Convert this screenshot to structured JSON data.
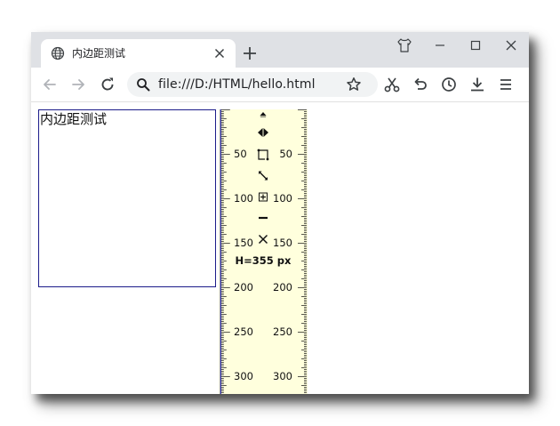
{
  "browser": {
    "tab_title": "内边距测试",
    "url": "file:///D:/HTML/hello.html"
  },
  "page": {
    "demo_text": "内边距测试"
  },
  "ruler": {
    "height_readout": "H=355 px",
    "labels": [
      "50",
      "100",
      "150",
      "200",
      "250",
      "300"
    ],
    "background": "#ffffdd"
  },
  "colors": {
    "titlebar": "#dfe1e5",
    "tab": "#ffffff",
    "omnibox": "#f1f3f4",
    "box_border": "#1c1c8a",
    "icon": "#5f6368"
  },
  "icons": {
    "tab": "globe-icon",
    "toolbar": [
      "back-arrow-icon",
      "forward-arrow-icon",
      "reload-icon",
      "search-icon",
      "star-icon",
      "scissors-icon",
      "undo-icon",
      "history-icon",
      "download-icon",
      "menu-icon"
    ],
    "window": [
      "shirt-icon",
      "minimize-icon",
      "maximize-icon",
      "close-icon"
    ]
  }
}
